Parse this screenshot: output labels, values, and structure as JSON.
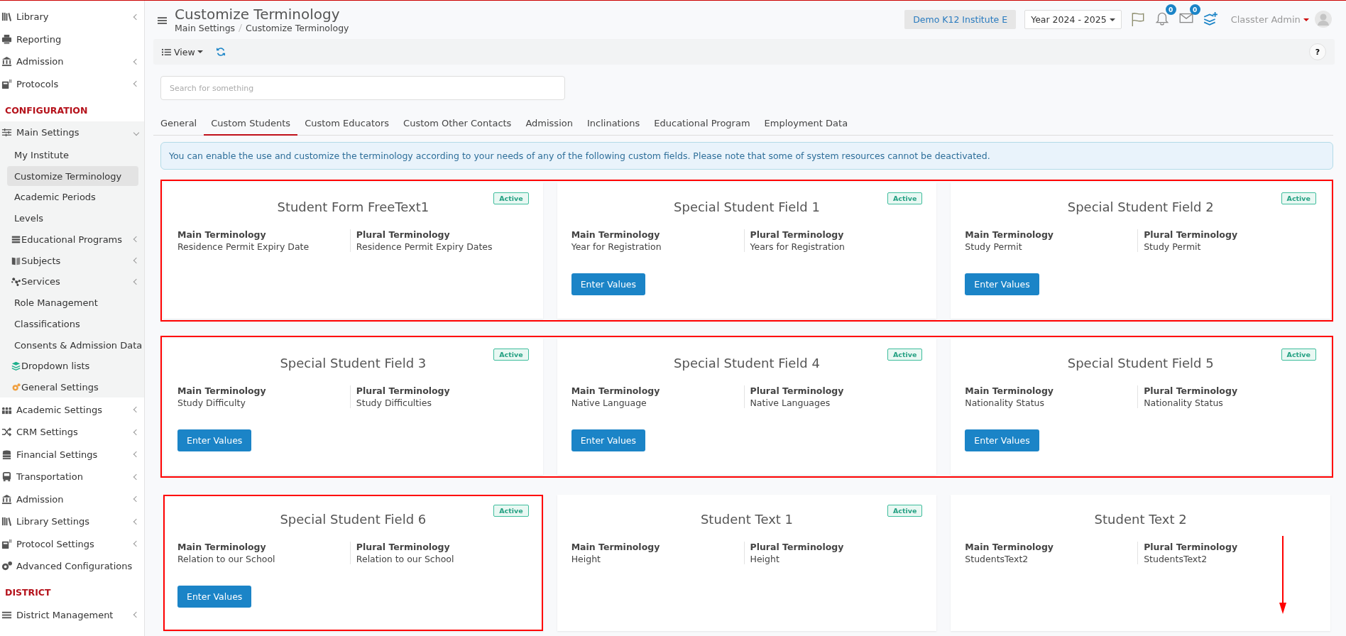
{
  "sidebar": {
    "sections": [
      {
        "items": [
          {
            "label": "Library",
            "expandable": true,
            "expanded": false
          },
          {
            "label": "Reporting",
            "expandable": false,
            "expanded": false
          },
          {
            "label": "Admission",
            "expandable": true,
            "expanded": false
          },
          {
            "label": "Protocols",
            "expandable": true,
            "expanded": false
          }
        ]
      },
      {
        "heading": "CONFIGURATION",
        "items": [
          {
            "label": "Main Settings",
            "expandable": true,
            "expanded": true,
            "children": [
              {
                "label": "My Institute",
                "selected": false,
                "expandable": false
              },
              {
                "label": "Customize Terminology",
                "selected": true,
                "expandable": false
              },
              {
                "label": "Academic Periods",
                "selected": false,
                "expandable": false
              },
              {
                "label": "Levels",
                "selected": false,
                "expandable": false
              },
              {
                "label": "Educational Programs",
                "selected": false,
                "expandable": true
              },
              {
                "label": "Subjects",
                "selected": false,
                "expandable": true
              },
              {
                "label": "Services",
                "selected": false,
                "expandable": true
              },
              {
                "label": "Role Management",
                "selected": false,
                "expandable": false
              },
              {
                "label": "Classifications",
                "selected": false,
                "expandable": false
              },
              {
                "label": "Consents & Admission Data",
                "selected": false,
                "expandable": false
              },
              {
                "label": "Dropdown lists",
                "selected": false,
                "expandable": false
              },
              {
                "label": "General Settings",
                "selected": false,
                "expandable": false
              }
            ]
          },
          {
            "label": "Academic Settings",
            "expandable": true,
            "expanded": false
          },
          {
            "label": "CRM Settings",
            "expandable": true,
            "expanded": false
          },
          {
            "label": "Financial Settings",
            "expandable": true,
            "expanded": false
          },
          {
            "label": "Transportation",
            "expandable": true,
            "expanded": false
          },
          {
            "label": "Admission",
            "expandable": true,
            "expanded": false
          },
          {
            "label": "Library Settings",
            "expandable": true,
            "expanded": false
          },
          {
            "label": "Protocol Settings",
            "expandable": true,
            "expanded": false
          },
          {
            "label": "Advanced Configurations",
            "expandable": false,
            "expanded": false
          }
        ]
      },
      {
        "heading": "DISTRICT",
        "items": [
          {
            "label": "District Management",
            "expandable": true,
            "expanded": false
          }
        ]
      }
    ]
  },
  "header": {
    "title": "Customize Terminology",
    "breadcrumb": [
      "Main Settings",
      "Customize Terminology"
    ],
    "institute": "Demo K12 Institute E",
    "year": "Year 2024 - 2025",
    "notifications": "0",
    "messages": "0",
    "user": "Classter Admin"
  },
  "toolbar": {
    "view": "View",
    "help": "?"
  },
  "search": {
    "placeholder": "Search for something"
  },
  "tabs": [
    {
      "label": "General",
      "selected": false
    },
    {
      "label": "Custom Students",
      "selected": true
    },
    {
      "label": "Custom Educators",
      "selected": false
    },
    {
      "label": "Custom Other Contacts",
      "selected": false
    },
    {
      "label": "Admission",
      "selected": false
    },
    {
      "label": "Inclinations",
      "selected": false
    },
    {
      "label": "Educational Program",
      "selected": false
    },
    {
      "label": "Employment Data",
      "selected": false
    }
  ],
  "info": "You can enable the use and customize the terminology according to your needs of any of the following custom fields. Please note that some of system resources cannot be deactivated.",
  "card_rows": [
    {
      "outlined": true,
      "cards": [
        {
          "title": "Student Form FreeText1",
          "badge": "Active",
          "outlined": false,
          "main_label": "Main Terminology",
          "main": "Residence Permit Expiry Date",
          "plural_label": "Plural Terminology",
          "plural": "Residence Permit Expiry Dates"
        },
        {
          "title": "Special Student Field 1",
          "badge": "Active",
          "outlined": false,
          "main_label": "Main Terminology",
          "main": "Year for Registration",
          "plural_label": "Plural Terminology",
          "plural": "Years for Registration",
          "button": "Enter Values"
        },
        {
          "title": "Special Student Field 2",
          "badge": "Active",
          "outlined": false,
          "main_label": "Main Terminology",
          "main": "Study Permit",
          "plural_label": "Plural Terminology",
          "plural": "Study Permit",
          "button": "Enter Values"
        }
      ]
    },
    {
      "outlined": true,
      "cards": [
        {
          "title": "Special Student Field 3",
          "badge": "Active",
          "outlined": false,
          "main_label": "Main Terminology",
          "main": "Study Difficulty",
          "plural_label": "Plural Terminology",
          "plural": "Study Difficulties",
          "button": "Enter Values"
        },
        {
          "title": "Special Student Field 4",
          "badge": "Active",
          "outlined": false,
          "main_label": "Main Terminology",
          "main": "Native Language",
          "plural_label": "Plural Terminology",
          "plural": "Native Languages",
          "button": "Enter Values"
        },
        {
          "title": "Special Student Field 5",
          "badge": "Active",
          "outlined": false,
          "main_label": "Main Terminology",
          "main": "Nationality Status",
          "plural_label": "Plural Terminology",
          "plural": "Nationality Status",
          "button": "Enter Values"
        }
      ]
    },
    {
      "outlined": false,
      "cards": [
        {
          "title": "Special Student Field 6",
          "badge": "Active",
          "outlined": true,
          "main_label": "Main Terminology",
          "main": "Relation to our School",
          "plural_label": "Plural Terminology",
          "plural": "Relation to our School",
          "button": "Enter Values"
        },
        {
          "title": "Student Text 1",
          "badge": "Active",
          "outlined": false,
          "main_label": "Main Terminology",
          "main": "Height",
          "plural_label": "Plural Terminology",
          "plural": "Height"
        },
        {
          "title": "Student Text 2",
          "outlined": false,
          "arrow_down": true,
          "main_label": "Main Terminology",
          "main": "StudentsText2",
          "plural_label": "Plural Terminology",
          "plural": "StudentsText2"
        }
      ]
    }
  ]
}
